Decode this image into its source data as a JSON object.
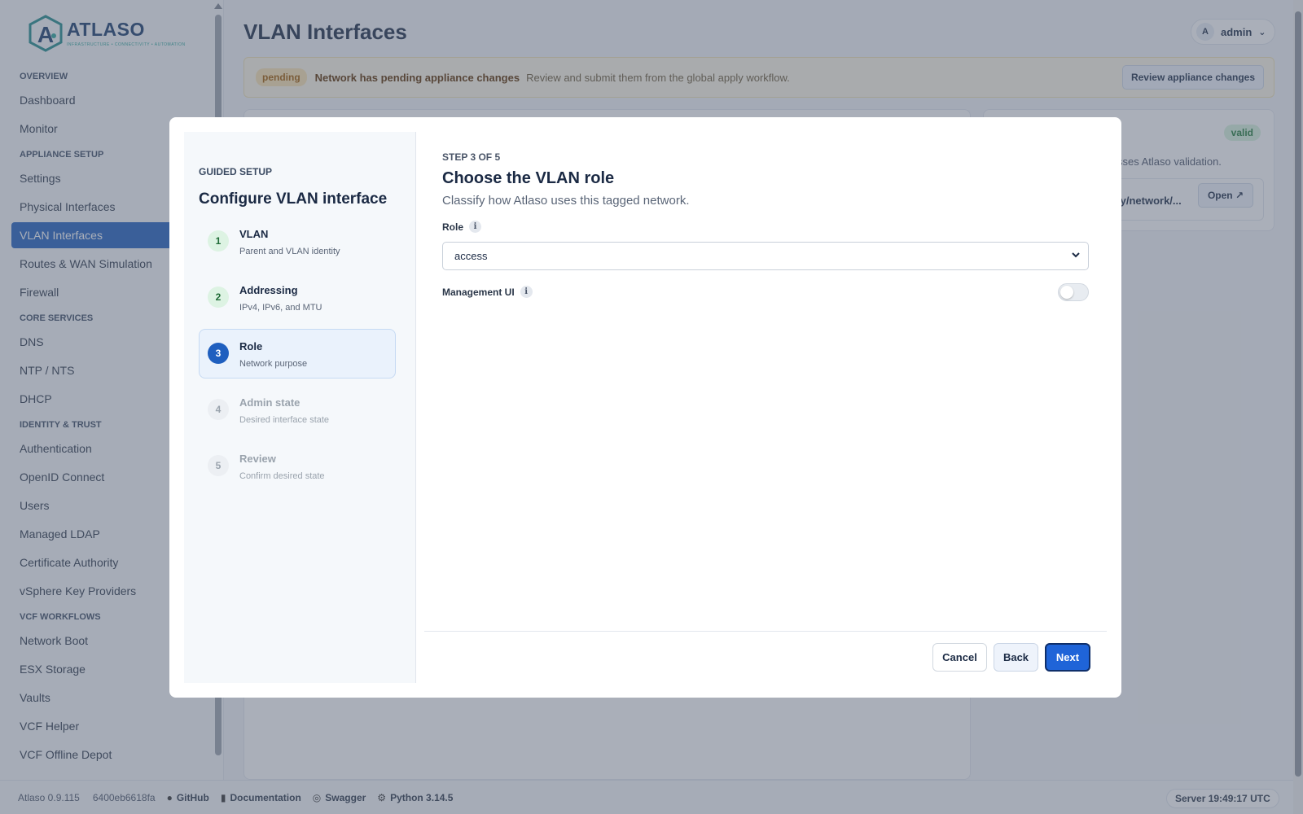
{
  "app": {
    "logo_name": "ATLASO",
    "logo_tagline": "INFRASTRUCTURE • CONNECTIVITY • AUTOMATION",
    "page_title": "VLAN Interfaces",
    "user": {
      "initial": "A",
      "name": "admin"
    }
  },
  "sidebar": {
    "sections": [
      {
        "title": "OVERVIEW",
        "items": [
          "Dashboard",
          "Monitor"
        ]
      },
      {
        "title": "APPLIANCE SETUP",
        "items": [
          "Settings",
          "Physical Interfaces",
          "VLAN Interfaces",
          "Routes & WAN Simulation",
          "Firewall"
        ]
      },
      {
        "title": "CORE SERVICES",
        "items": [
          "DNS",
          "NTP / NTS",
          "DHCP"
        ]
      },
      {
        "title": "IDENTITY & TRUST",
        "items": [
          "Authentication",
          "OpenID Connect",
          "Users",
          "Managed LDAP",
          "Certificate Authority",
          "vSphere Key Providers"
        ]
      },
      {
        "title": "VCF WORKFLOWS",
        "items": [
          "Network Boot",
          "ESX Storage",
          "Vaults",
          "VCF Helper",
          "VCF Offline Depot"
        ]
      }
    ],
    "active_item": "VLAN Interfaces"
  },
  "banner": {
    "badge": "pending",
    "strong": "Network has pending appliance changes",
    "text": "Review and submit them from the global apply workflow.",
    "button": "Review appliance changes"
  },
  "right_card": {
    "badge": "valid",
    "text": "sses Atlaso validation.",
    "path": "ly/network/...",
    "open_button": "Open ↗"
  },
  "footer": {
    "version": "Atlaso 0.9.115",
    "hash": "6400eb6618fa",
    "github": "GitHub",
    "docs": "Documentation",
    "swagger": "Swagger",
    "python": "Python 3.14.5",
    "server_time": "Server 19:49:17 UTC"
  },
  "modal": {
    "guided_label": "GUIDED SETUP",
    "title": "Configure VLAN interface",
    "steps": [
      {
        "num": "1",
        "label": "VLAN",
        "desc": "Parent and VLAN identity",
        "state": "done"
      },
      {
        "num": "2",
        "label": "Addressing",
        "desc": "IPv4, IPv6, and MTU",
        "state": "done"
      },
      {
        "num": "3",
        "label": "Role",
        "desc": "Network purpose",
        "state": "current"
      },
      {
        "num": "4",
        "label": "Admin state",
        "desc": "Desired interface state",
        "state": "todo"
      },
      {
        "num": "5",
        "label": "Review",
        "desc": "Confirm desired state",
        "state": "todo"
      }
    ],
    "step_of": "STEP 3 OF 5",
    "content_title": "Choose the VLAN role",
    "content_subtitle": "Classify how Atlaso uses this tagged network.",
    "role_label": "Role",
    "role_value": "access",
    "mgmt_label": "Management UI",
    "mgmt_enabled": false,
    "buttons": {
      "cancel": "Cancel",
      "back": "Back",
      "next": "Next"
    }
  },
  "colors": {
    "accent": "#1f5fbf",
    "next_button": "#1f64d8",
    "pending_badge_bg": "#fbe3b0",
    "valid_badge_bg": "#d7f2dd"
  }
}
